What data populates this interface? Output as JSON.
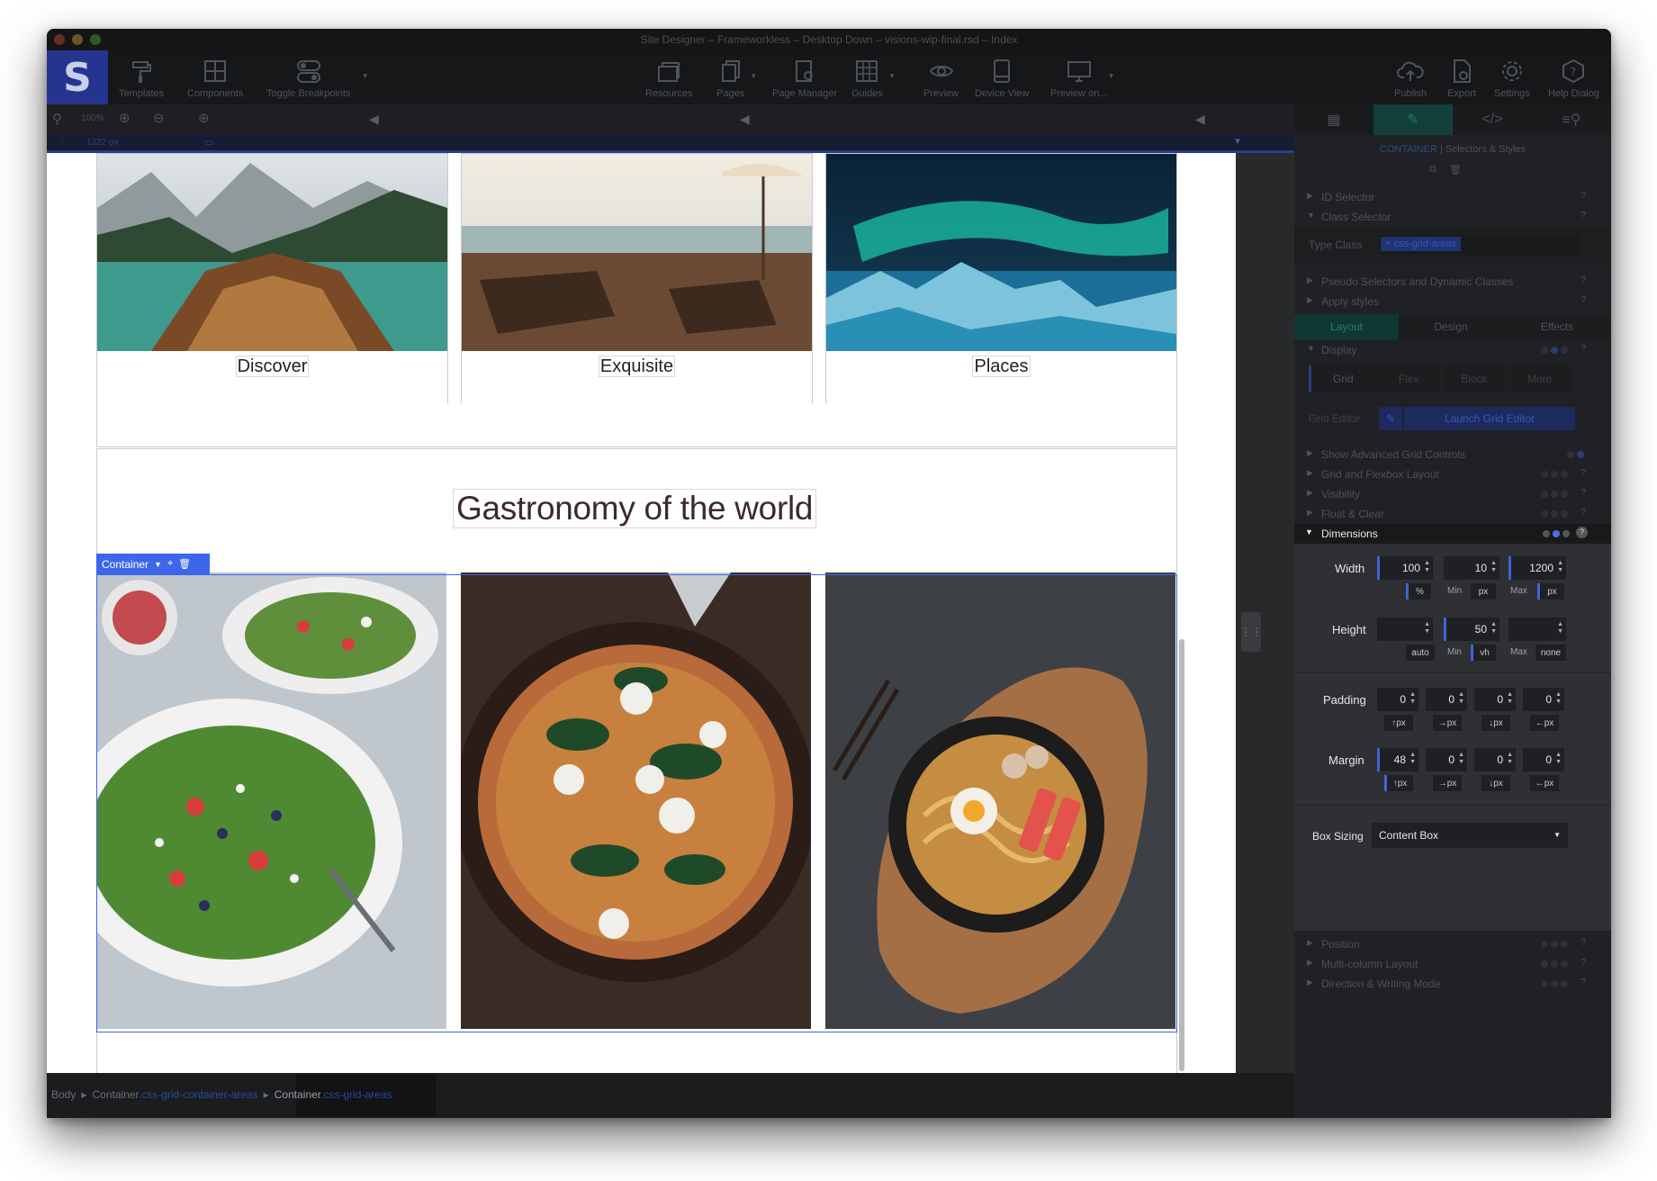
{
  "window": {
    "title": "Site Designer – Frameworkless – Desktop Down – visions-wip-final.rsd – Index"
  },
  "app": {
    "logo_letter": "S"
  },
  "toolbar": {
    "left": [
      {
        "label": "Templates",
        "icon": "paint-roller-icon"
      },
      {
        "label": "Components",
        "icon": "components-icon"
      },
      {
        "label": "Toggle Breakpoints",
        "icon": "toggle-icon"
      }
    ],
    "center": [
      {
        "label": "Resources",
        "icon": "resources-icon"
      },
      {
        "label": "Pages",
        "icon": "pages-icon"
      },
      {
        "label": "Page Manager",
        "icon": "page-manager-icon"
      },
      {
        "label": "Guides",
        "icon": "grid-icon"
      },
      {
        "label": "Preview",
        "icon": "eye-icon"
      },
      {
        "label": "Device View",
        "icon": "device-icon"
      },
      {
        "label": "Preview on...",
        "icon": "monitor-icon"
      }
    ],
    "right": [
      {
        "label": "Publish",
        "icon": "cloud-upload-icon"
      },
      {
        "label": "Export",
        "icon": "export-icon"
      },
      {
        "label": "Settings",
        "icon": "gear-icon"
      },
      {
        "label": "Help Dialog",
        "icon": "help-icon"
      }
    ]
  },
  "zoom": {
    "value": "100%"
  },
  "ruler": {
    "width": "1322 px"
  },
  "canvas": {
    "cards": [
      "Discover",
      "Exquisite",
      "Places"
    ],
    "heading": "Gastronomy of the world",
    "container_tag": "Container"
  },
  "statusbar": {
    "items": [
      {
        "label": "Body",
        "class": ""
      },
      {
        "label": "Container",
        "class": ".css-grid-container-areas"
      },
      {
        "label": "Container",
        "class": ".css-grid-areas"
      }
    ]
  },
  "panel": {
    "header": {
      "element": "CONTAINER",
      "rest": "| Selectors & Styles"
    },
    "id_selector": "ID Selector",
    "class_selector": "Class Selector",
    "type_class_label": "Type Class",
    "type_class_chip": "× css-grid-areas",
    "pseudo": "Pseudo Selectors and Dynamic Classes",
    "apply_styles": "Apply styles",
    "tabs": [
      "Layout",
      "Design",
      "Effects"
    ],
    "display": "Display",
    "display_options": [
      "Grid",
      "Flex",
      "Block",
      "More"
    ],
    "grid_editor_label": "Grid Editor",
    "launch_grid_editor": "Launch Grid Editor",
    "sections_before": [
      "Show Advanced Grid Controls",
      "Grid and Flexbox Layout",
      "Visibility",
      "Float & Clear"
    ],
    "dimensions": {
      "title": "Dimensions",
      "width": {
        "label": "Width",
        "value": "100",
        "unit": "%",
        "min": "10",
        "min_label": "Min",
        "min_unit": "px",
        "max": "1200",
        "max_label": "Max",
        "max_unit": "px"
      },
      "height": {
        "label": "Height",
        "value": "",
        "unit": "auto",
        "min": "50",
        "min_label": "Min",
        "min_unit": "vh",
        "max": "",
        "max_label": "Max",
        "max_unit": "none"
      },
      "padding": {
        "label": "Padding",
        "values": [
          "0",
          "0",
          "0",
          "0"
        ],
        "units": [
          "↑px",
          "→px",
          "↓px",
          "←px"
        ]
      },
      "margin": {
        "label": "Margin",
        "values": [
          "48",
          "0",
          "0",
          "0"
        ],
        "units": [
          "↑px",
          "→px",
          "↓px",
          "←px"
        ]
      },
      "box_sizing": {
        "label": "Box Sizing",
        "value": "Content Box"
      }
    },
    "sections_after": [
      "Position",
      "Multi-column Layout",
      "Direction & Writing Mode"
    ],
    "colors": {
      "accent": "#3f63d6",
      "selection": "#3e66e8",
      "active_tab": "#123f39"
    }
  }
}
